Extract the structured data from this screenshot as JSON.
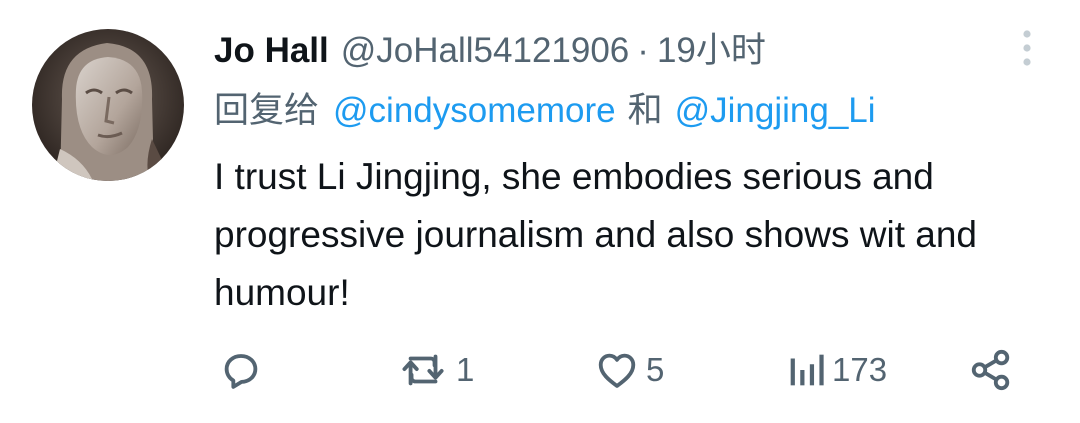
{
  "tweet": {
    "author": {
      "display_name": "Jo Hall",
      "handle": "@JoHall54121906",
      "avatar_description": "stone statue face"
    },
    "separator": "·",
    "timestamp": "19小时",
    "reply_prefix": "回复给",
    "reply_mention_1": "@cindysomemore",
    "reply_conjunction": "和",
    "reply_mention_2": "@Jingjing_Li",
    "text": "I trust Li Jingjing, she embodies serious and progressive journalism and also shows wit and humour!"
  },
  "actions": {
    "reply_icon": "reply-icon",
    "retweet_icon": "retweet-icon",
    "retweet_count": "1",
    "like_icon": "heart-icon",
    "like_count": "5",
    "views_icon": "analytics-icon",
    "views_count": "173",
    "share_icon": "share-icon",
    "more_icon": "more-vertical-icon"
  },
  "colors": {
    "text_primary": "#0f1419",
    "text_secondary": "#536471",
    "link": "#1d9bf0"
  }
}
